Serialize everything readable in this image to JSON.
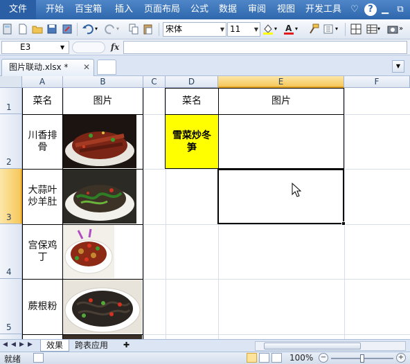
{
  "menubar": {
    "file": "文件",
    "items": [
      "开始",
      "百宝箱",
      "插入",
      "页面布局",
      "公式",
      "数据",
      "审阅",
      "视图",
      "开发工具"
    ],
    "help_icon": "?"
  },
  "toolbar": {
    "font_name": "宋体",
    "font_size": "11"
  },
  "formulabar": {
    "cell_ref": "E3",
    "fx_label": "fx",
    "formula": ""
  },
  "doc_tab": {
    "title": "图片联动.xlsx *",
    "close": "✕"
  },
  "grid": {
    "columns": [
      "A",
      "B",
      "C",
      "D",
      "E",
      "F"
    ],
    "rows": [
      "1",
      "2",
      "3",
      "4",
      "5"
    ],
    "active_col": "E",
    "active_row": "3",
    "table_left": {
      "header_name": "菜名",
      "header_pic": "图片",
      "dishes": [
        "川香排骨",
        "大蒜叶炒羊肚",
        "宫保鸡丁",
        "蕨根粉"
      ]
    },
    "table_right": {
      "header_name": "菜名",
      "header_pic": "图片",
      "selected_dish": "雪菜炒冬笋"
    }
  },
  "sheets": {
    "tabs": [
      "效果",
      "跨表应用"
    ],
    "active": "效果"
  },
  "statusbar": {
    "status": "就绪",
    "zoom": "100%"
  },
  "colors": {
    "menubar": "#3a74bf",
    "highlight_yellow": "#ffff00",
    "active_header": "#f6c75a"
  }
}
